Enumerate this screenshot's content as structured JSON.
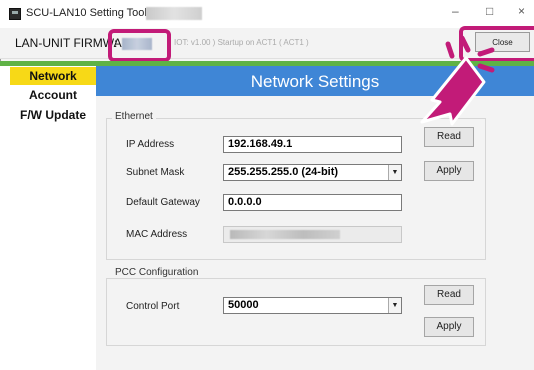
{
  "window": {
    "title": "SCU-LAN10 Setting Tool - Ver",
    "controls": {
      "minimize": "–",
      "maximize": "□",
      "close": "×"
    }
  },
  "firmware": {
    "label": "LAN-UNIT FIRMWA",
    "colon": ":",
    "status": "IOT: v1.00 ) Startup on ACT1 ( ACT1 )"
  },
  "close_button": {
    "label": "Close"
  },
  "sidebar": {
    "items": [
      {
        "label": "Network",
        "active": true
      },
      {
        "label": "Account",
        "active": false
      },
      {
        "label": "F/W Update",
        "active": false
      }
    ]
  },
  "header": {
    "title": "Network Settings"
  },
  "ethernet": {
    "legend": "Ethernet",
    "ip_label": "IP Address",
    "ip_value": "192.168.49.1",
    "subnet_label": "Subnet Mask",
    "subnet_value": "255.255.255.0 (24-bit)",
    "gateway_label": "Default Gateway",
    "gateway_value": "0.0.0.0",
    "mac_label": "MAC Address",
    "read_label": "Read",
    "apply_label": "Apply"
  },
  "pcc": {
    "legend": "PCC Configuration",
    "port_label": "Control Port",
    "port_value": "50000",
    "read_label": "Read",
    "apply_label": "Apply"
  },
  "colors": {
    "accent_blue": "#3f86d6",
    "accent_green": "#5fb246",
    "active_tab": "#f7d917",
    "highlight": "#c21b78"
  },
  "icons": {
    "app": "app-icon",
    "pointer": "hand-pointer-icon",
    "dropdown": "chevron-down-icon"
  }
}
